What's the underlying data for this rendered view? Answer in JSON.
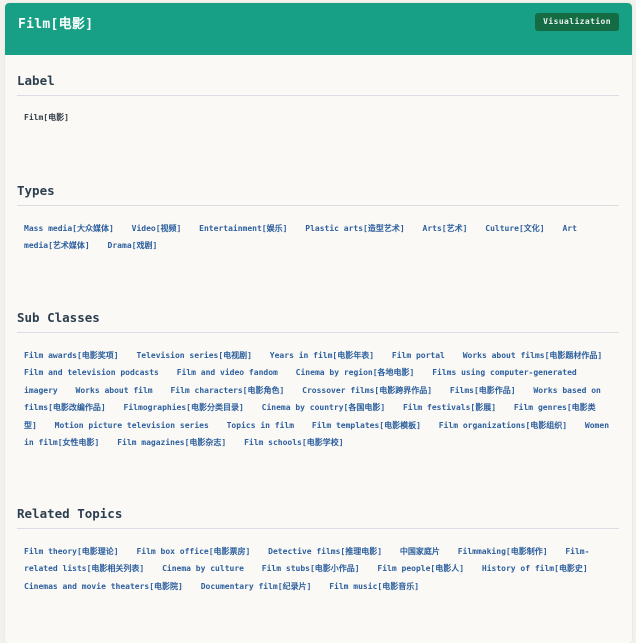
{
  "header": {
    "title": "Film[电影]",
    "viz_button": "Visualization"
  },
  "sections": {
    "label": {
      "title": "Label",
      "value": "Film[电影]"
    },
    "types": {
      "title": "Types",
      "items": [
        "Mass media[大众媒体]",
        "Video[视频]",
        "Entertainment[娱乐]",
        "Plastic arts[造型艺术]",
        "Arts[艺术]",
        "Culture[文化]",
        "Art media[艺术媒体]",
        "Drama[戏剧]"
      ]
    },
    "subclasses": {
      "title": "Sub Classes",
      "items": [
        "Film awards[电影奖项]",
        "Television series[电视剧]",
        "Years in film[电影年表]",
        "Film portal",
        "Works about films[电影题材作品]",
        "Film and television podcasts",
        "Film and video fandom",
        "Cinema by region[各地电影]",
        "Films using computer-generated imagery",
        "Works about film",
        "Film characters[电影角色]",
        "Crossover films[电影跨界作品]",
        "Films[电影作品]",
        "Works based on films[电影改编作品]",
        "Filmographies[电影分类目录]",
        "Cinema by country[各国电影]",
        "Film festivals[影展]",
        "Film genres[电影类型]",
        "Motion picture television series",
        "Topics in film",
        "Film templates[电影模板]",
        "Film organizations[电影组织]",
        "Women in film[女性电影]",
        "Film magazines[电影杂志]",
        "Film schools[电影学校]"
      ]
    },
    "related": {
      "title": "Related Topics",
      "items": [
        "Film theory[电影理论]",
        "Film box office[电影票房]",
        "Detective films[推理电影]",
        "中国家庭片",
        "Filmmaking[电影制作]",
        "Film-related lists[电影相关列表]",
        "Cinema by culture",
        "Film stubs[电影小作品]",
        "Film people[电影人]",
        "History of film[电影史]",
        "Cinemas and movie theaters[电影院]",
        "Documentary film[纪录片]",
        "Film music[电影音乐]"
      ]
    }
  }
}
